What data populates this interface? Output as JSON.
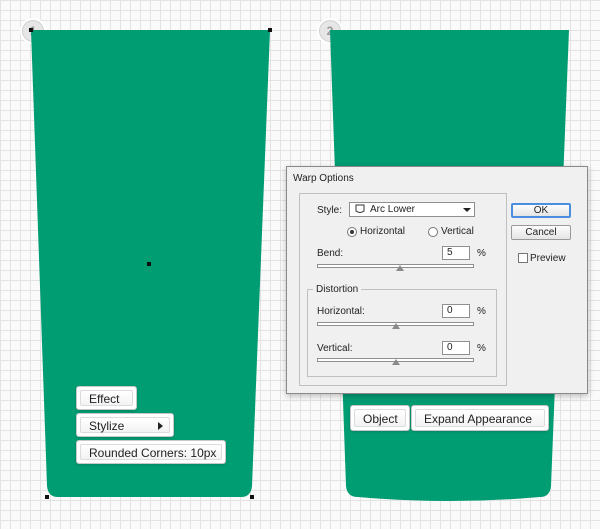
{
  "steps": [
    "1",
    "2"
  ],
  "colors": {
    "shape_fill": "#009c72",
    "grid_line": "#e3e3e3"
  },
  "step1": {
    "menu": {
      "effect": "Effect",
      "stylize": "Stylize",
      "rounded_corners": "Rounded Corners: 10px"
    }
  },
  "step2": {
    "bottom_bar": {
      "object": "Object",
      "expand_appearance": "Expand Appearance"
    }
  },
  "warp_dialog": {
    "title": "Warp Options",
    "style_label": "Style:",
    "style_value": "Arc Lower",
    "horizontal_label": "Horizontal",
    "vertical_label": "Vertical",
    "orientation_selected": "Horizontal",
    "bend_label": "Bend:",
    "bend_value": "5",
    "percent": "%",
    "distortion_legend": "Distortion",
    "dist_horizontal_label": "Horizontal:",
    "dist_horizontal_value": "0",
    "dist_vertical_label": "Vertical:",
    "dist_vertical_value": "0",
    "ok": "OK",
    "cancel": "Cancel",
    "preview": "Preview",
    "preview_checked": false
  }
}
